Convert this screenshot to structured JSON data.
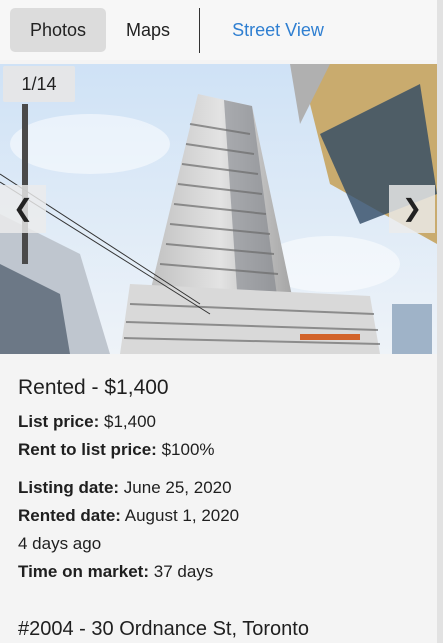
{
  "tabs": {
    "photos": "Photos",
    "maps": "Maps",
    "street_view": "Street View"
  },
  "gallery": {
    "counter": "1/14",
    "prev_icon": "chevron-left-icon",
    "prev_glyph": "❮",
    "next_icon": "chevron-right-icon",
    "next_glyph": "❯"
  },
  "listing": {
    "status_price": "Rented - $1,400",
    "list_price_label": "List price:",
    "list_price_value": "$1,400",
    "rent_to_list_label": "Rent to list price:",
    "rent_to_list_value": "$100%",
    "listing_date_label": "Listing date:",
    "listing_date_value": "June 25, 2020",
    "rented_date_label": "Rented date:",
    "rented_date_value": "August 1, 2020",
    "relative_time": "4 days ago",
    "time_on_market_label": "Time on market:",
    "time_on_market_value": "37 days",
    "address": "#2004 - 30 Ordnance St, Toronto"
  },
  "colors": {
    "link_blue": "#2f7fd1",
    "active_tab_bg": "#dcdcdc"
  }
}
